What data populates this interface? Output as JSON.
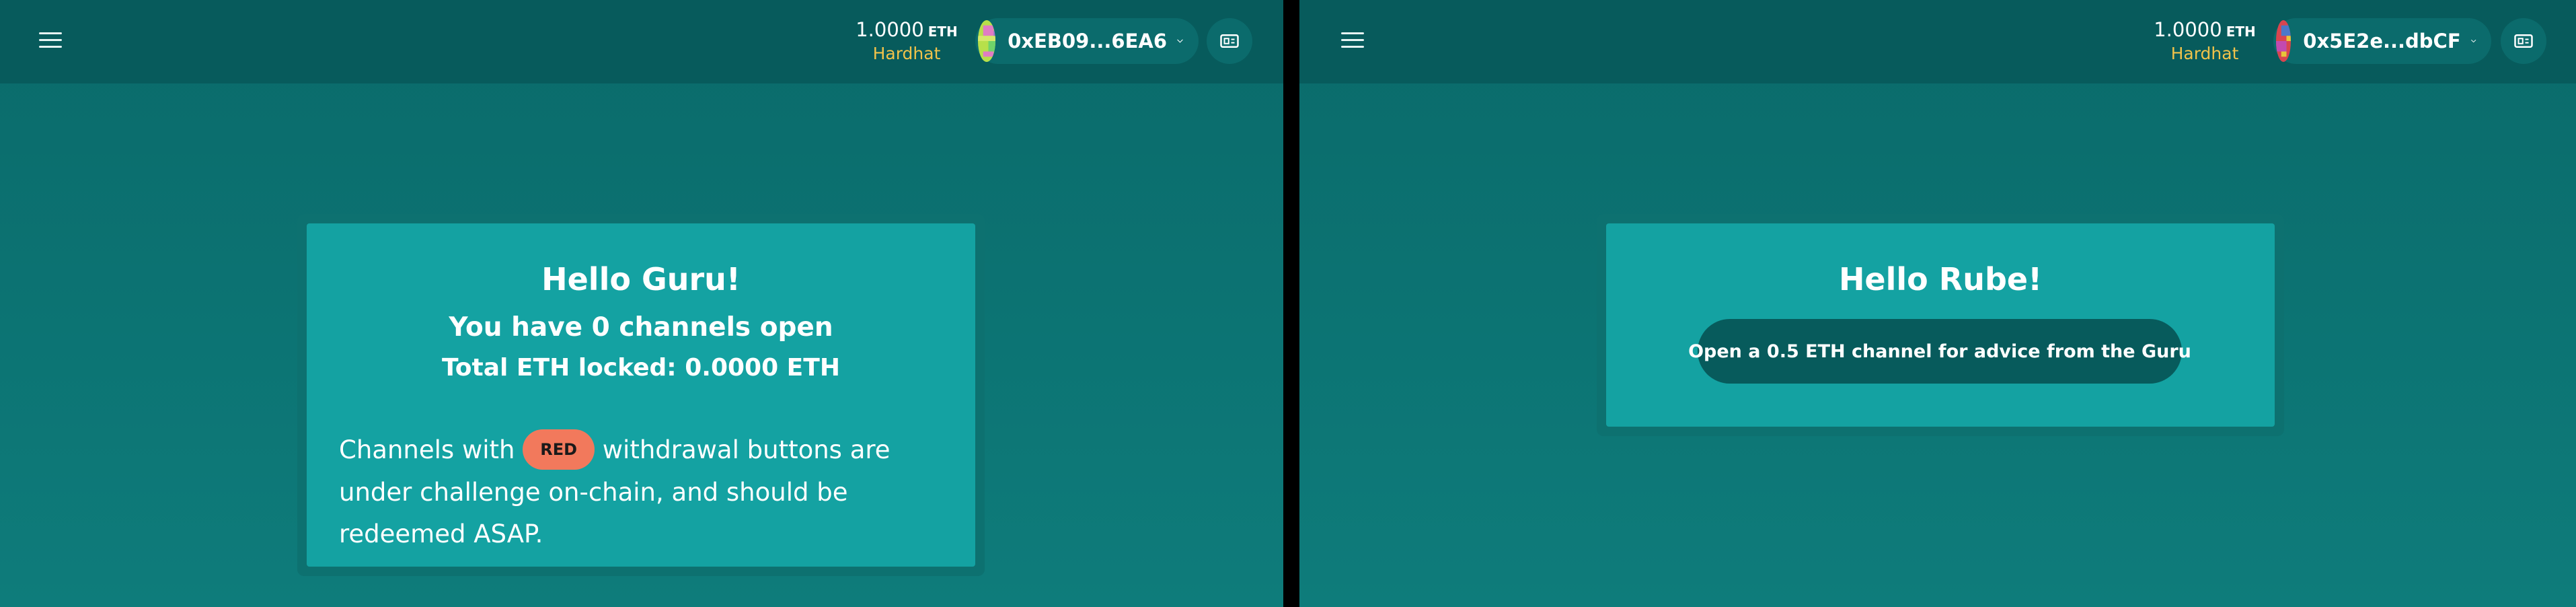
{
  "left": {
    "header": {
      "balance_amount": "1.0000",
      "balance_unit": "ETH",
      "network": "Hardhat",
      "address": "0xEB09...6EA6"
    },
    "card": {
      "greeting": "Hello Guru!",
      "channels_open": "You have 0 channels open",
      "total_locked": "Total ETH locked: 0.0000 ETH",
      "note_before": "Channels with",
      "badge": "RED",
      "note_after": "withdrawal buttons are under challenge on-chain, and should be redeemed ASAP."
    }
  },
  "right": {
    "header": {
      "balance_amount": "1.0000",
      "balance_unit": "ETH",
      "network": "Hardhat",
      "address": "0x5E2e...dbCF"
    },
    "card": {
      "greeting": "Hello Rube!",
      "open_channel_button": "Open a 0.5 ETH channel for advice from the Guru"
    }
  },
  "icons": [
    "menu-icon",
    "chevron-down-icon",
    "qr-code-icon",
    "blockie-avatar"
  ],
  "colors": {
    "background": "#0e7c7b",
    "header": "#075b5c",
    "card": "#14a2a2",
    "network_label": "#f0c24a",
    "badge": "#f2795c"
  }
}
